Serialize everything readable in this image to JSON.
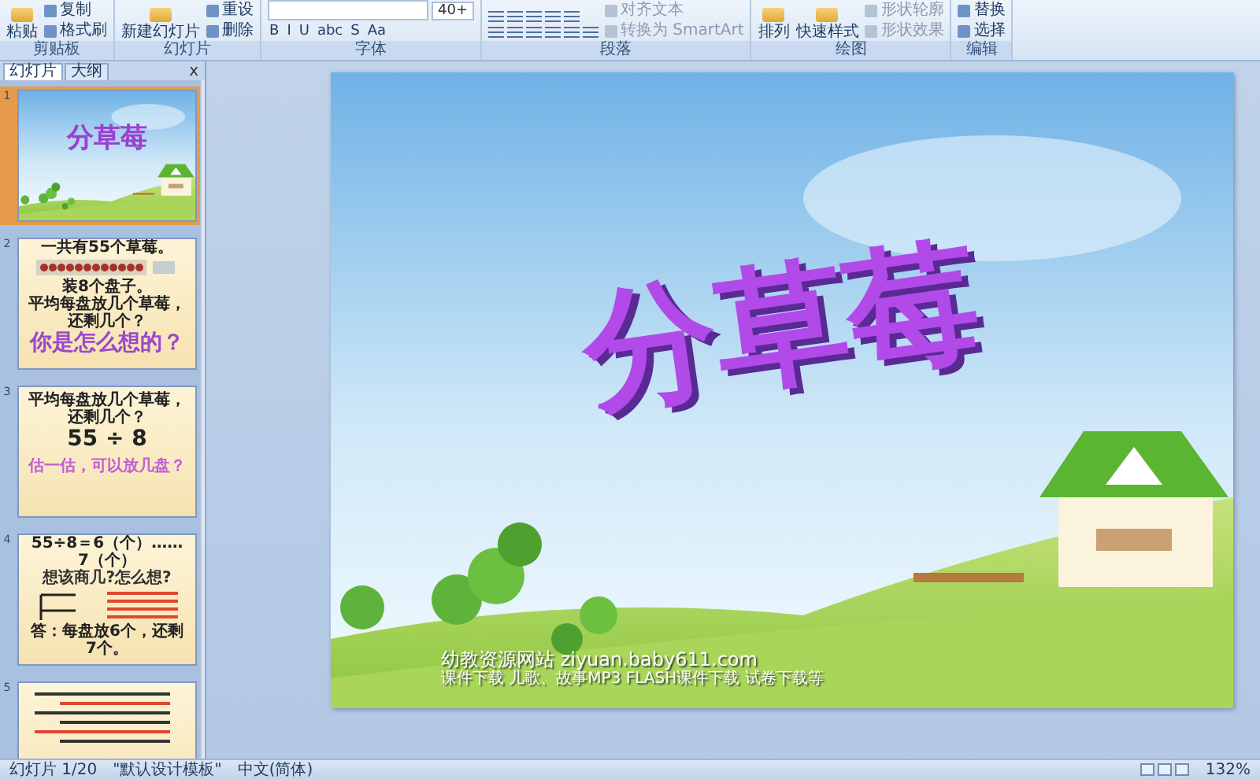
{
  "ribbon": {
    "groups": [
      {
        "kind": "buttons",
        "label": "剪贴板",
        "large": [
          "粘贴"
        ],
        "small": [
          {
            "label": "复制",
            "disabled": false
          },
          {
            "label": "格式刷",
            "disabled": false
          }
        ]
      },
      {
        "kind": "buttons",
        "label": "幻灯片",
        "large": [
          "新建幻灯片"
        ],
        "small": [
          {
            "label": "重设",
            "disabled": false
          },
          {
            "label": "删除",
            "disabled": false
          }
        ]
      },
      {
        "kind": "font",
        "label": "字体",
        "font_size": "40+",
        "styles": [
          "B",
          "I",
          "U",
          "abc",
          "S",
          "Aa"
        ]
      },
      {
        "kind": "paragraph",
        "label": "段落",
        "small": [
          {
            "label": "对齐文本",
            "disabled": true
          },
          {
            "label": "转换为 SmartArt",
            "disabled": true
          }
        ]
      },
      {
        "kind": "buttons",
        "label": "绘图",
        "large": [
          "排列",
          "快速样式"
        ],
        "small": [
          {
            "label": "形状轮廓",
            "disabled": true
          },
          {
            "label": "形状效果",
            "disabled": true
          }
        ]
      },
      {
        "kind": "buttons",
        "label": "编辑",
        "small": [
          {
            "label": "替换",
            "disabled": false
          },
          {
            "label": "选择",
            "disabled": false
          }
        ]
      }
    ]
  },
  "panel": {
    "tabs": [
      {
        "label": "幻灯片",
        "selected": true
      },
      {
        "label": "大纲",
        "selected": false
      }
    ],
    "close": "x",
    "slides": [
      {
        "number": "1",
        "kind": "title",
        "selected": true,
        "texts": [
          "分草莓"
        ]
      },
      {
        "number": "2",
        "kind": "tray",
        "selected": false,
        "texts": [
          "一共有55个草莓。",
          "装8个盘子。",
          "平均每盘放几个草莓，还剩几个？",
          "你是怎么想的？"
        ]
      },
      {
        "number": "3",
        "kind": "question",
        "selected": false,
        "texts": [
          "平均每盘放几个草莓，还剩几个？",
          "55 ÷ 8",
          "估一估，可以放几盘？"
        ]
      },
      {
        "number": "4",
        "kind": "division",
        "selected": false,
        "texts": [
          "55÷8＝6（个）……7（个）",
          "想该商几?怎么想?",
          "答：每盘放6个，还剩7个。"
        ]
      },
      {
        "number": "5",
        "kind": "notes",
        "selected": false
      }
    ]
  },
  "slide": {
    "title": "分草莓",
    "site": "幼教资源网站  ziyuan.baby611.com",
    "tagline": "课件下载  儿歌、故事MP3  FLASH课件下载  试卷下载等"
  },
  "status_bar": {
    "slide_info": "幻灯片 1/20",
    "theme": "\"默认设计模板\"",
    "language": "中文(简体)",
    "zoom": "132%"
  }
}
